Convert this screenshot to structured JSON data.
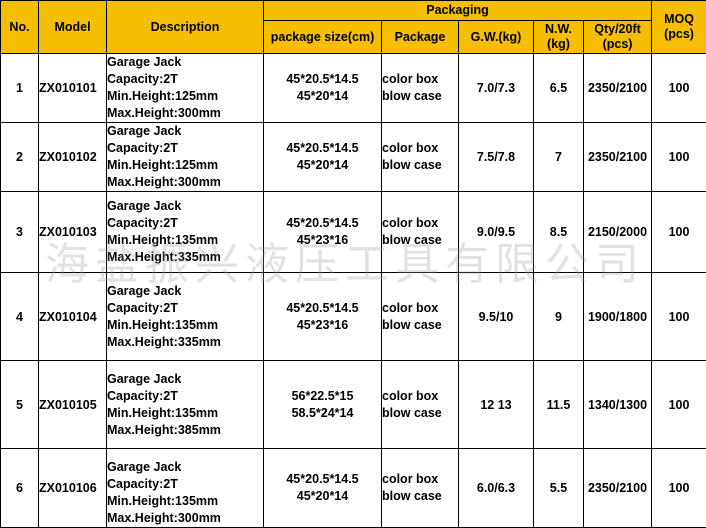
{
  "headers": {
    "no": "No.",
    "model": "Model",
    "description": "Description",
    "packaging": "Packaging",
    "package_size": "package size(cm)",
    "package": "Package",
    "gw": "G.W.(kg)",
    "nw_line1": "N.W.",
    "nw_line2": "(kg)",
    "qty_line1": "Qty/20ft",
    "qty_line2": "(pcs)",
    "moq_line1": "MOQ",
    "moq_line2": "(pcs)"
  },
  "rows": [
    {
      "no": "1",
      "model": "ZX010101",
      "desc": [
        "Garage Jack",
        "Capacity:2T",
        "Min.Height:125mm",
        "Max.Height:300mm"
      ],
      "size": [
        "45*20.5*14.5",
        "45*20*14"
      ],
      "package": [
        "color box",
        "blow case"
      ],
      "gw": "7.0/7.3",
      "nw": "6.5",
      "qty": "2350/2100",
      "moq": "100"
    },
    {
      "no": "2",
      "model": "ZX010102",
      "desc": [
        "Garage Jack",
        "Capacity:2T",
        "Min.Height:125mm",
        "Max.Height:300mm"
      ],
      "size": [
        "45*20.5*14.5",
        "45*20*14"
      ],
      "package": [
        "color box",
        "blow case"
      ],
      "gw": "7.5/7.8",
      "nw": "7",
      "qty": "2350/2100",
      "moq": "100"
    },
    {
      "no": "3",
      "model": "ZX010103",
      "desc": [
        "Garage Jack",
        "Capacity:2T",
        "Min.Height:135mm",
        "Max.Height:335mm"
      ],
      "size": [
        "45*20.5*14.5",
        "45*23*16"
      ],
      "package": [
        "color box",
        "blow case"
      ],
      "gw": "9.0/9.5",
      "nw": "8.5",
      "qty": "2150/2000",
      "moq": "100"
    },
    {
      "no": "4",
      "model": "ZX010104",
      "desc": [
        "Garage Jack",
        "Capacity:2T",
        "Min.Height:135mm",
        "Max.Height:335mm"
      ],
      "size": [
        "45*20.5*14.5",
        "45*23*16"
      ],
      "package": [
        "color box",
        "blow case"
      ],
      "gw": "9.5/10",
      "nw": "9",
      "qty": "1900/1800",
      "moq": "100"
    },
    {
      "no": "5",
      "model": "ZX010105",
      "desc": [
        "Garage Jack",
        "Capacity:2T",
        "Min.Height:135mm",
        "Max.Height:385mm"
      ],
      "size": [
        "56*22.5*15",
        "58.5*24*14"
      ],
      "package": [
        "color box",
        "blow case"
      ],
      "gw": "12 13",
      "nw": "11.5",
      "qty": "1340/1300",
      "moq": "100"
    },
    {
      "no": "6",
      "model": "ZX010106",
      "desc": [
        "Garage Jack",
        "Capacity:2T",
        "Min.Height:135mm",
        "Max.Height:300mm"
      ],
      "size": [
        "45*20.5*14.5",
        "45*20*14"
      ],
      "package": [
        "color box",
        "blow case"
      ],
      "gw": "6.0/6.3",
      "nw": "5.5",
      "qty": "2350/2100",
      "moq": "100"
    }
  ],
  "watermark": "海盐振兴液压工具有限公司",
  "colors": {
    "header_fill": "#f5be00",
    "border": "#000000",
    "watermark": "#969696"
  }
}
